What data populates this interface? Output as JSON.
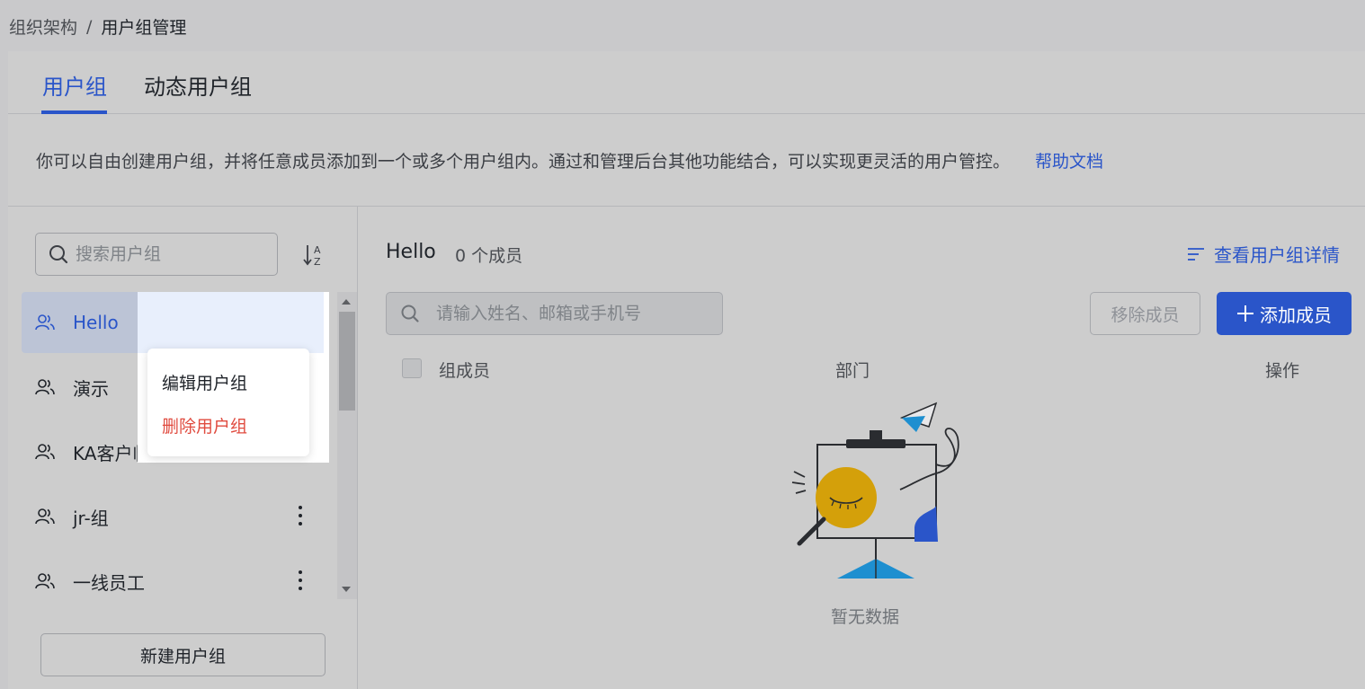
{
  "breadcrumb": {
    "root": "组织架构",
    "separator": "/",
    "current": "用户组管理"
  },
  "tabs": [
    {
      "label": "用户组",
      "active": true
    },
    {
      "label": "动态用户组",
      "active": false
    }
  ],
  "description": {
    "text": "你可以自由创建用户组，并将任意成员添加到一个或多个用户组内。通过和管理后台其他功能结合，可以实现更灵活的用户管控。",
    "help_link": "帮助文档"
  },
  "sidebar": {
    "search_placeholder": "搜索用户组",
    "groups": [
      {
        "label": "Hello",
        "selected": true
      },
      {
        "label": "演示",
        "selected": false
      },
      {
        "label": "KA客户临时群组",
        "selected": false
      },
      {
        "label": "jr-组",
        "selected": false
      },
      {
        "label": "一线员工",
        "selected": false
      }
    ],
    "new_group_label": "新建用户组"
  },
  "context_menu": {
    "edit_label": "编辑用户组",
    "delete_label": "删除用户组"
  },
  "main": {
    "group_title": "Hello",
    "member_count": "0 个成员",
    "detail_link": "查看用户组详情",
    "member_search_placeholder": "请输入姓名、邮箱或手机号",
    "remove_label": "移除成员",
    "add_label": "添加成员",
    "columns": [
      "组成员",
      "部门",
      "操作"
    ],
    "empty_text": "暂无数据"
  },
  "colors": {
    "accent": "#2a55c9",
    "danger": "#e04b3f",
    "illustration_yellow": "#d4a00a",
    "illustration_blue": "#1e8fd0"
  },
  "icons": [
    "search-icon",
    "sort-az-icon",
    "user-group-icon",
    "more-vertical-icon",
    "list-icon",
    "plus-icon"
  ]
}
